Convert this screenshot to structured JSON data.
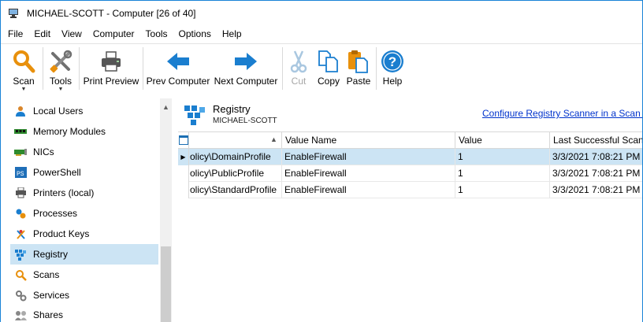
{
  "window": {
    "title": "MICHAEL-SCOTT - Computer [26 of 40]",
    "icon": "computer-icon"
  },
  "menu": [
    "File",
    "Edit",
    "View",
    "Computer",
    "Tools",
    "Options",
    "Help"
  ],
  "toolbar": {
    "scan": "Scan",
    "tools": "Tools",
    "print_preview": "Print Preview",
    "prev_computer": "Prev Computer",
    "next_computer": "Next Computer",
    "cut": "Cut",
    "copy": "Copy",
    "paste": "Paste",
    "help": "Help",
    "dropdown_glyph": "▼",
    "help_glyph": "?"
  },
  "sidebar": {
    "items": [
      {
        "label": "Local Users",
        "icon": "user-icon"
      },
      {
        "label": "Memory Modules",
        "icon": "memory-icon"
      },
      {
        "label": "NICs",
        "icon": "network-card-icon"
      },
      {
        "label": "PowerShell",
        "icon": "powershell-icon"
      },
      {
        "label": "Printers (local)",
        "icon": "printer-icon"
      },
      {
        "label": "Processes",
        "icon": "processes-icon"
      },
      {
        "label": "Product Keys",
        "icon": "key-icon"
      },
      {
        "label": "Registry",
        "icon": "registry-icon",
        "selected": true
      },
      {
        "label": "Scans",
        "icon": "scan-icon"
      },
      {
        "label": "Services",
        "icon": "services-icon"
      },
      {
        "label": "Shares",
        "icon": "shares-icon"
      }
    ],
    "scroll_up_glyph": "▲"
  },
  "main": {
    "title": "Registry",
    "subtitle": "MICHAEL-SCOTT",
    "link": "Configure Registry Scanner in a Scan P",
    "columns": [
      "",
      "Value Name",
      "Value",
      "Last Successful Scan"
    ],
    "sort_glyph": "▲",
    "row_pointer_glyph": "▶",
    "rows": [
      {
        "key": "olicy\\DomainProfile",
        "value_name": "EnableFirewall",
        "value": "1",
        "last_scan": "3/3/2021 7:08:21 PM",
        "selected": true
      },
      {
        "key": "olicy\\PublicProfile",
        "value_name": "EnableFirewall",
        "value": "1",
        "last_scan": "3/3/2021 7:08:21 PM"
      },
      {
        "key": "olicy\\StandardProfile",
        "value_name": "EnableFirewall",
        "value": "1",
        "last_scan": "3/3/2021 7:08:21 PM"
      }
    ]
  },
  "colors": {
    "accent": "#1883d7",
    "selection": "#cce4f4",
    "link": "#0033cc",
    "arrow_blue": "#1a7ecf",
    "scan_orange": "#e8900c"
  }
}
